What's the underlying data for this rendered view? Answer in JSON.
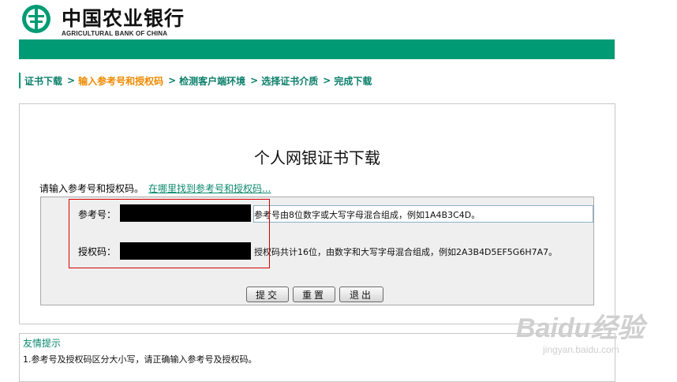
{
  "brand": {
    "name_cn": "中国农业银行",
    "name_en": "AGRICULTURAL BANK OF CHINA",
    "logo_icon": "abc-bank-logo-icon",
    "green": "#009b74",
    "accent_orange": "#ef8a00"
  },
  "steps": [
    {
      "label": "证书下载",
      "active": false
    },
    {
      "label": "输入参考号和授权码",
      "active": true
    },
    {
      "label": "检测客户端环境",
      "active": false
    },
    {
      "label": "选择证书介质",
      "active": false
    },
    {
      "label": "完成下载",
      "active": false
    }
  ],
  "step_separator": ">",
  "page": {
    "title": "个人网银证书下载",
    "prompt": "请输入参考号和授权码。",
    "help_link": "在哪里找到参考号和授权码..."
  },
  "form": {
    "ref_label": "参考号：",
    "ref_hint": "参考号由8位数字或大写字母混合组成，例如1A4B3C4D。",
    "auth_label": "授权码：",
    "auth_hint": "授权码共计16位，由数字和大写字母混合组成，例如2A3B4D5EF5G6H7A7。"
  },
  "buttons": {
    "submit": "提交",
    "reset": "重置",
    "exit": "退出"
  },
  "tips": {
    "title": "友情提示",
    "line1": "1.参考号及授权码区分大小写，请正确输入参考号及授权码。"
  },
  "watermark": {
    "brand": "Baidu经验",
    "url": "jingyan.baidu.com"
  }
}
